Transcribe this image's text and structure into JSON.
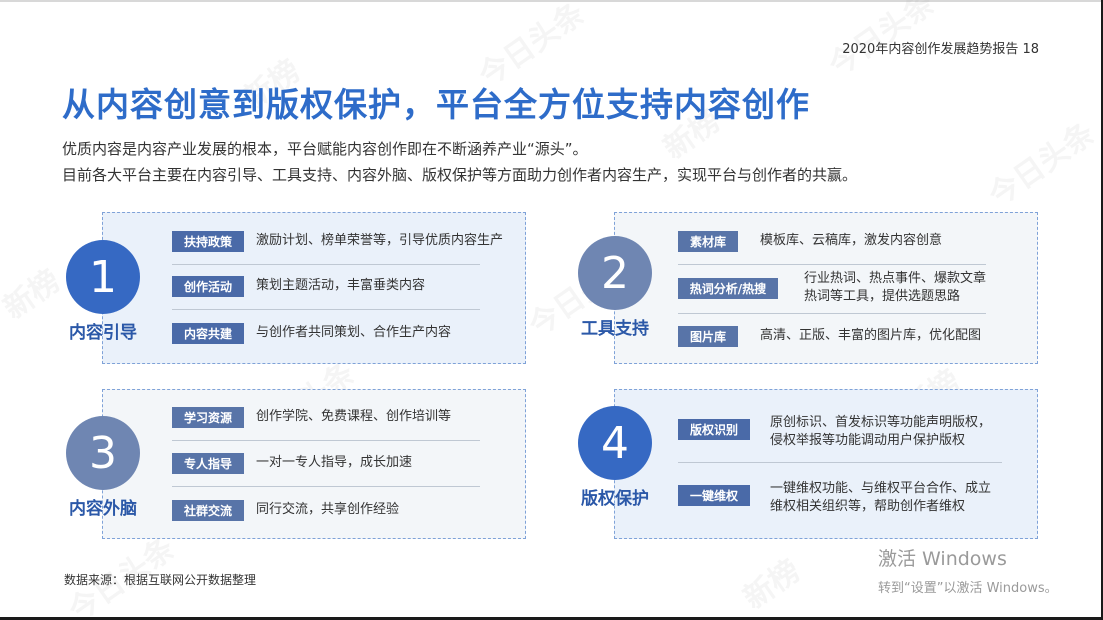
{
  "header": {
    "report_title": "2020年内容创作发展趋势报告  18"
  },
  "title": "从内容创意到版权保护，平台全方位支持内容创作",
  "intro": {
    "line1": "优质内容是内容产业发展的根本，平台赋能内容创作即在不断涵养产业“源头”。",
    "line2": "目前各大平台主要在内容引导、工具支持、内容外脑、版权保护等方面助力创作者内容生产，实现平台与创作者的共赢。"
  },
  "sections": [
    {
      "number": "1",
      "label": "内容引导",
      "items": [
        {
          "tag": "扶持政策",
          "desc": [
            "激励计划、榜单荣誉等，引导优质内容生产"
          ]
        },
        {
          "tag": "创作活动",
          "desc": [
            "策划主题活动，丰富垂类内容"
          ]
        },
        {
          "tag": "内容共建",
          "desc": [
            "与创作者共同策划、合作生产内容"
          ]
        }
      ]
    },
    {
      "number": "2",
      "label": "工具支持",
      "items": [
        {
          "tag": "素材库",
          "desc": [
            "模板库、云稿库，激发内容创意"
          ]
        },
        {
          "tag": "热词分析/热搜",
          "desc": [
            "行业热词、热点事件、爆款文章",
            "热词等工具，提供选题思路"
          ]
        },
        {
          "tag": "图片库",
          "desc": [
            "高清、正版、丰富的图片库，优化配图"
          ]
        }
      ]
    },
    {
      "number": "3",
      "label": "内容外脑",
      "items": [
        {
          "tag": "学习资源",
          "desc": [
            "创作学院、免费课程、创作培训等"
          ]
        },
        {
          "tag": "专人指导",
          "desc": [
            "一对一专人指导，成长加速"
          ]
        },
        {
          "tag": "社群交流",
          "desc": [
            "同行交流，共享创作经验"
          ]
        }
      ]
    },
    {
      "number": "4",
      "label": "版权保护",
      "items": [
        {
          "tag": "版权识别",
          "desc": [
            "原创标识、首发标识等功能声明版权，",
            "侵权举报等功能调动用户保护版权"
          ]
        },
        {
          "tag": "一键维权",
          "desc": [
            "一键维权功能、与维权平台合作、成立",
            "维权相关组织等，帮助创作者维权"
          ]
        }
      ]
    }
  ],
  "source": "数据来源：根据互联网公开数据整理",
  "watermarks": {
    "brand1": "今日头条",
    "brand2": "新榜"
  },
  "os_overlay": {
    "line1": "激活 Windows",
    "line2": "转到“设置”以激活 Windows。"
  }
}
